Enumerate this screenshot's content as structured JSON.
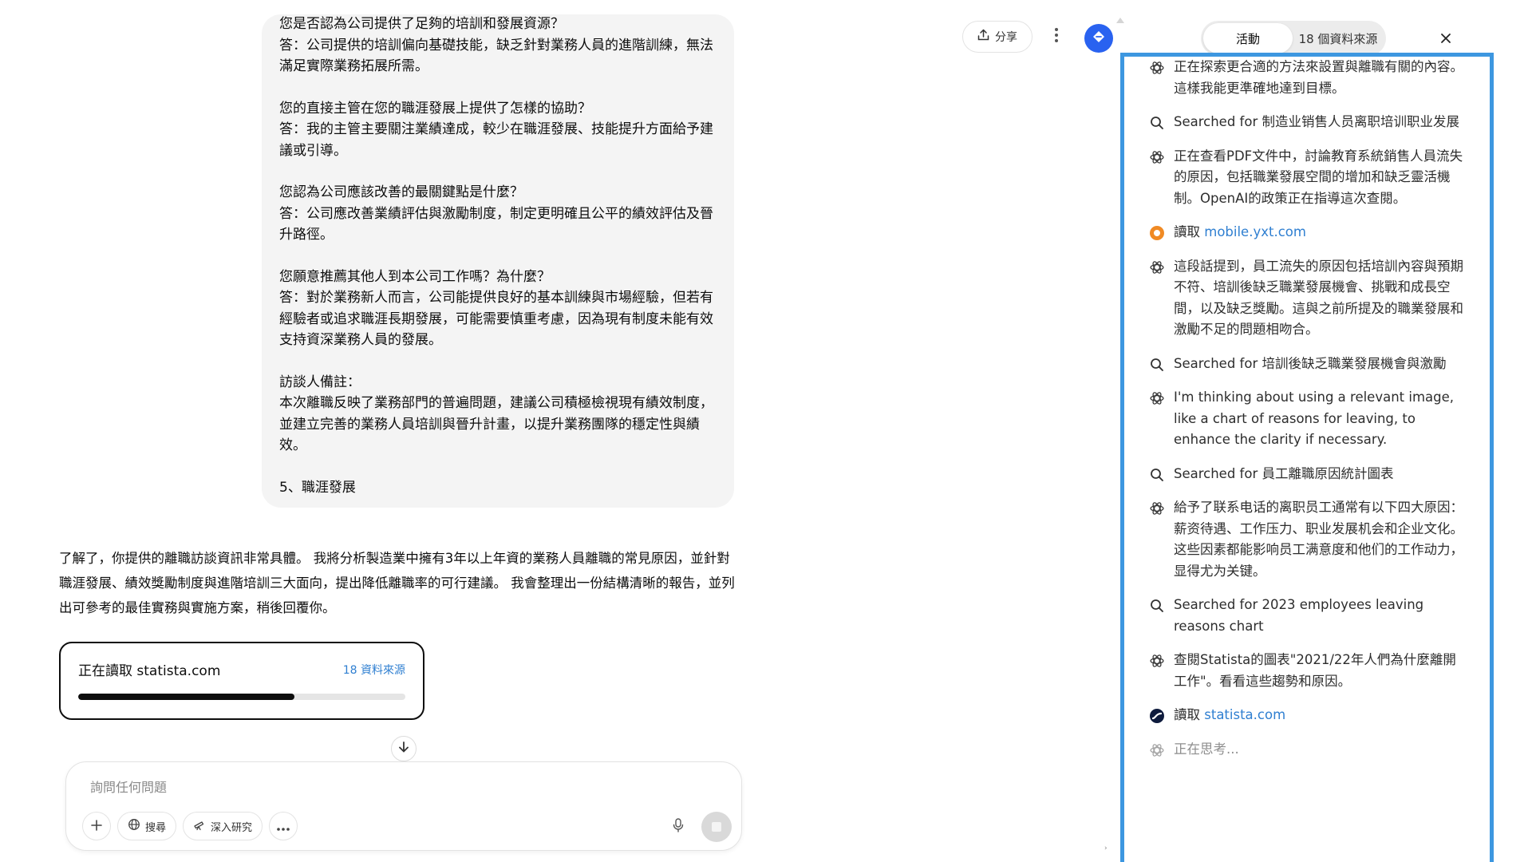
{
  "conversation": {
    "user_message": [
      "您是否認為公司提供了足夠的培訓和發展資源？\n答：公司提供的培訓偏向基礎技能，缺乏針對業務人員的進階訓練，無法滿足實際業務拓展所需。",
      "您的直接主管在您的職涯發展上提供了怎樣的協助？\n答：我的主管主要關注業績達成，較少在職涯發展、技能提升方面給予建議或引導。",
      "您認為公司應該改善的最關鍵點是什麼？\n答：公司應改善業績評估與激勵制度，制定更明確且公平的績效評估及晉升路徑。",
      "您願意推薦其他人到本公司工作嗎？為什麼？\n答：對於業務新人而言，公司能提供良好的基本訓練與市場經驗，但若有經驗者或追求職涯長期發展，可能需要慎重考慮，因為現有制度未能有效支持資深業務人員的發展。",
      "訪談人備註：\n本次離職反映了業務部門的普遍問題，建議公司積極檢視現有績效制度，並建立完善的業務人員培訓與晉升計畫，以提升業務團隊的穩定性與績效。",
      "5、職涯發展"
    ],
    "assistant_message": "了解了，你提供的離職訪談資訊非常具體。 我將分析製造業中擁有3年以上年資的業務人員離職的常見原因，並針對職涯發展、績效獎勵制度與進階培訓三大面向，提出降低離職率的可行建議。 我會整理出一份結構清晰的報告，並列出可參考的最佳實務與實施方案，稍後回覆你。"
  },
  "reading_card": {
    "status": "正在讀取 statista.com",
    "sources": "18 資料來源",
    "progress": 0.66
  },
  "composer": {
    "placeholder": "詢問任何問題",
    "value": "",
    "search_label": "搜尋",
    "deep_research_label": "深入研究"
  },
  "toolbar": {
    "share_label": "分享"
  },
  "sidebar": {
    "tab_activity": "活動",
    "tab_sources": "18 個資料來源",
    "items": [
      {
        "icon": "openai-icon",
        "text": "正在探索更合適的方法來設置與離職有關的內容。這樣我能更準確地達到目標。"
      },
      {
        "icon": "search-icon",
        "text": "Searched for 制造业销售人员离职培训职业发展"
      },
      {
        "icon": "openai-icon",
        "text": "正在查看PDF文件中，討論教育系統銷售人員流失的原因，包括職業發展空間的增加和缺乏靈活機制。OpenAI的政策正在指導這次查閱。"
      },
      {
        "icon": "site-favicon-icon",
        "prefix": "讀取 ",
        "link": "mobile.yxt.com"
      },
      {
        "icon": "openai-icon",
        "text": "這段話提到，員工流失的原因包括培訓內容與預期不符、培訓後缺乏職業發展機會、挑戰和成長空間，以及缺乏獎勵。這與之前所提及的職業發展和激勵不足的問題相吻合。"
      },
      {
        "icon": "search-icon",
        "text": "Searched for 培訓後缺乏職業發展機會與激勵"
      },
      {
        "icon": "openai-icon",
        "text": "I'm thinking about using a relevant image, like a chart of reasons for leaving, to enhance the clarity if necessary."
      },
      {
        "icon": "search-icon",
        "text": "Searched for 員工離職原因統計圖表"
      },
      {
        "icon": "openai-icon",
        "text": "給予了联系电话的离职员工通常有以下四大原因：薪资待遇、工作压力、职业发展机会和企业文化。这些因素都能影响员工满意度和他们的工作动力，显得尤为关键。"
      },
      {
        "icon": "search-icon",
        "text": "Searched for 2023 employees leaving reasons chart"
      },
      {
        "icon": "openai-icon",
        "text": "查閱Statista的圖表\"2021/22年人們為什麼離開工作\"。看看這些趨勢和原因。"
      },
      {
        "icon": "statista-icon",
        "prefix": "讀取 ",
        "link": "statista.com"
      },
      {
        "icon": "openai-icon",
        "text": "正在思考..."
      }
    ]
  },
  "colors": {
    "accent_blue": "#3d97e0",
    "link_blue": "#2f7fd1",
    "extension_blue": "#2962f0"
  }
}
